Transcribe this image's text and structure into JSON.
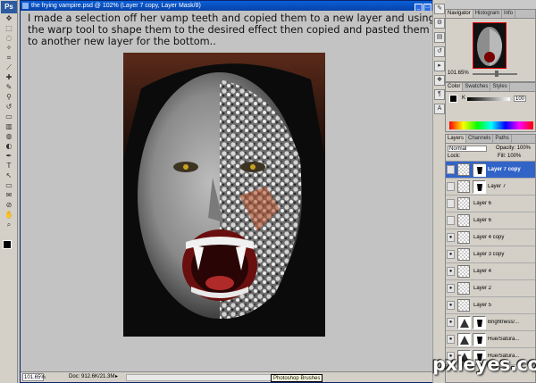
{
  "document": {
    "title": "the frying vampire.psd @ 102% (Layer 7 copy, Layer Mask/8)",
    "caption": "I made a selection off her vamp teeth and copied them to a new layer and using the warp tool to shape them to the desired effect then copied and pasted them to another new layer for the bottom..",
    "zoom": "101.65%",
    "doc_size": "Doc: 912.6K/21.3M",
    "status_arrow": "▸"
  },
  "tooltip": "Photoshop Brushes",
  "toolbox": {
    "logo": "Ps",
    "tools": [
      "move-tool",
      "marquee-tool",
      "lasso-tool",
      "magic-wand-tool",
      "crop-tool",
      "slice-tool",
      "healing-tool",
      "brush-tool",
      "stamp-tool",
      "history-brush-tool",
      "eraser-tool",
      "gradient-tool",
      "blur-tool",
      "dodge-tool",
      "pen-tool",
      "type-tool",
      "path-select-tool",
      "shape-tool",
      "notes-tool",
      "eyedropper-tool",
      "hand-tool",
      "zoom-tool"
    ],
    "glyphs": [
      "✥",
      "⬚",
      "◌",
      "✧",
      "⌗",
      "⟋",
      "✚",
      "✎",
      "⚲",
      "↺",
      "▭",
      "▥",
      "◍",
      "◐",
      "✒",
      "T",
      "↖",
      "▭",
      "✉",
      "⊘",
      "✋",
      "⌕"
    ],
    "foreground_color": "#000000",
    "background_color": "#ffffff"
  },
  "navigator": {
    "tabs": [
      "Navigator",
      "Histogram",
      "Info"
    ],
    "zoom": "101.65%"
  },
  "color_panel": {
    "tabs": [
      "Color",
      "Swatches",
      "Styles"
    ],
    "label": "K",
    "value": "100"
  },
  "layers_panel": {
    "tabs": [
      "Layers",
      "Channels",
      "Paths"
    ],
    "blend_mode": "Normal",
    "opacity_label": "Opacity: 100%",
    "lock_label": "Lock:",
    "fill_label": "Fill: 100%",
    "layers": [
      {
        "name": "Layer 7 copy",
        "visible": false,
        "selected": true,
        "mask": true,
        "type": "pixel"
      },
      {
        "name": "Layer 7",
        "visible": false,
        "selected": false,
        "mask": true,
        "type": "pixel"
      },
      {
        "name": "Layer 6",
        "visible": false,
        "selected": false,
        "mask": false,
        "type": "pixel"
      },
      {
        "name": "Layer 6",
        "visible": false,
        "selected": false,
        "mask": false,
        "type": "pixel"
      },
      {
        "name": "Layer 4 copy",
        "visible": true,
        "selected": false,
        "mask": false,
        "type": "pixel"
      },
      {
        "name": "Layer 3 copy",
        "visible": true,
        "selected": false,
        "mask": false,
        "type": "pixel"
      },
      {
        "name": "Layer 4",
        "visible": true,
        "selected": false,
        "mask": false,
        "type": "pixel"
      },
      {
        "name": "Layer 2",
        "visible": true,
        "selected": false,
        "mask": false,
        "type": "pixel"
      },
      {
        "name": "Layer 5",
        "visible": true,
        "selected": false,
        "mask": false,
        "type": "pixel"
      },
      {
        "name": "Brightness/...",
        "visible": true,
        "selected": false,
        "mask": true,
        "type": "adjustment"
      },
      {
        "name": "Hue/Satura...",
        "visible": true,
        "selected": false,
        "mask": true,
        "type": "adjustment"
      },
      {
        "name": "Hue/Satura...",
        "visible": true,
        "selected": false,
        "mask": true,
        "type": "adjustment"
      }
    ]
  },
  "watermark": "pxleyes.com"
}
